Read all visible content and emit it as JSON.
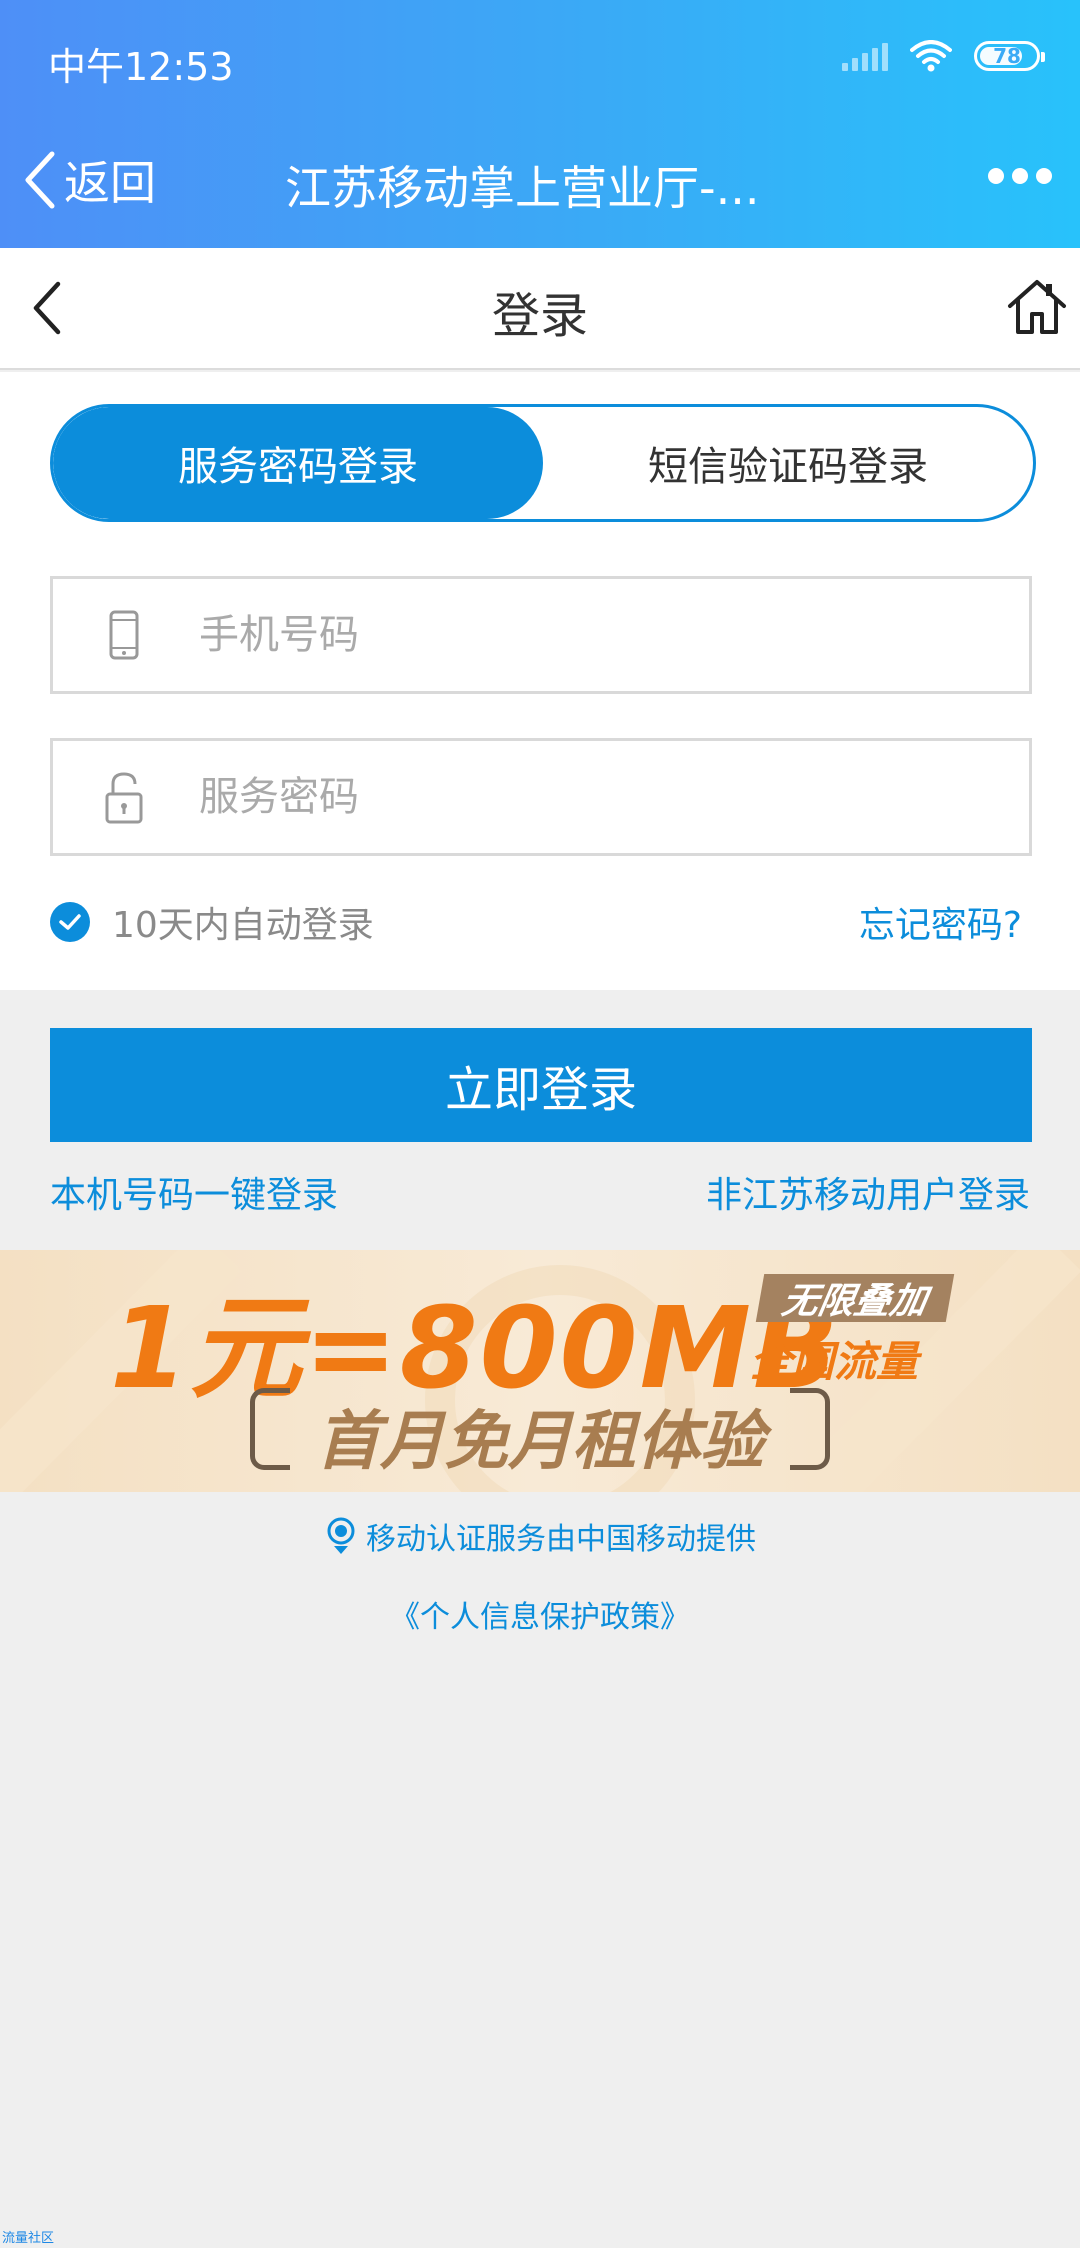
{
  "status_bar": {
    "time": "中午12:53",
    "battery": "78",
    "battery_level": 0.78,
    "icons": [
      "signal-icon",
      "wifi-icon",
      "battery-icon"
    ]
  },
  "app_bar": {
    "back_label": "返回",
    "title": "江苏移动掌上营业厅-...",
    "more_icon": "more-dots-icon"
  },
  "page_header": {
    "title": "登录",
    "back_icon": "chevron-left-icon",
    "home_icon": "home-icon"
  },
  "login_tabs": [
    {
      "label": "服务密码登录",
      "active": true
    },
    {
      "label": "短信验证码登录",
      "active": false
    }
  ],
  "form": {
    "phone_placeholder": "手机号码",
    "password_placeholder": "服务密码",
    "auto_login_label": "10天内自动登录",
    "auto_login_checked": true,
    "forgot_password": "忘记密码?"
  },
  "actions": {
    "login_button": "立即登录",
    "one_click_login": "本机号码一键登录",
    "non_jiangsu_login": "非江苏移动用户登录"
  },
  "banner": {
    "headline": "1元=800MB",
    "badge": "无限叠加",
    "badge_sub": "全国流量",
    "subline": "首月免月租体验"
  },
  "footer": {
    "auth_notice": "移动认证服务由中国移动提供",
    "privacy_policy": "《个人信息保护政策》",
    "watermark": "流量社区"
  },
  "colors": {
    "accent": "#0c8ddb",
    "topbar_start": "#4e8ff7",
    "topbar_end": "#28c2fb",
    "banner_orange": "#f07a14"
  }
}
